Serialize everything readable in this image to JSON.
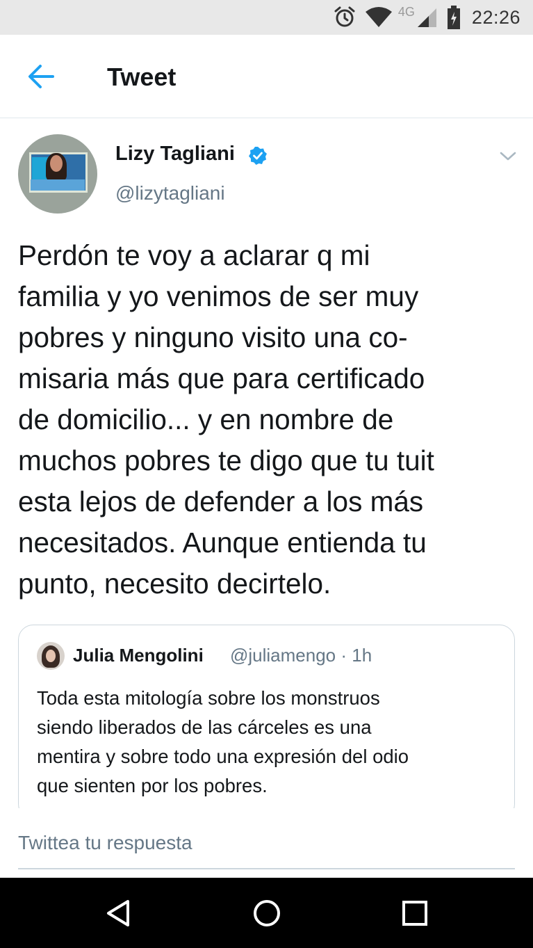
{
  "status_bar": {
    "icons": [
      "alarm-icon",
      "wifi-icon",
      "signal-icon",
      "battery-icon"
    ],
    "network": "4G",
    "time": "22:26"
  },
  "header": {
    "back_icon": "arrow-left-icon",
    "title": "Tweet"
  },
  "tweet": {
    "author_name": "Lizy Tagliani",
    "verified": true,
    "handle": "@lizytagliani",
    "menu_icon": "chevron-down-icon",
    "text_lines": [
      "Perdón te voy a aclarar q mi",
      "familia y yo venimos de ser muy",
      "pobres y ninguno visito una co-",
      "misaria más que para certificado",
      "de domicilio... y en nombre de",
      "muchos pobres te digo que tu tuit",
      "esta lejos de defender a los más",
      "necesitados. Aunque entienda tu",
      "punto, necesito decirtelo."
    ],
    "quote": {
      "author_name": "Julia Mengolini",
      "handle_time": "@juliamengo · 1h",
      "text_lines": [
        "Toda esta mitología sobre los monstruos",
        "siendo liberados de las cárceles es una",
        "mentira y sobre todo una expresión del odio",
        "que sienten por los pobres."
      ]
    }
  },
  "reply": {
    "placeholder": "Twittea tu respuesta"
  },
  "nav_bar": {
    "buttons": [
      "back-triangle-icon",
      "home-circle-icon",
      "recents-square-icon"
    ]
  },
  "colors": {
    "accent": "#1da1f2",
    "secondary_text": "#657786",
    "status_bar_bg": "#e8e8e8",
    "nav_bar_bg": "#000000"
  }
}
